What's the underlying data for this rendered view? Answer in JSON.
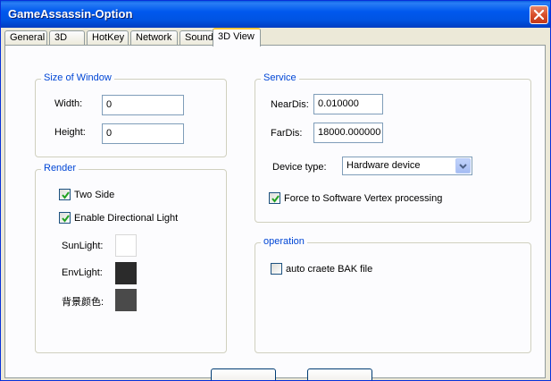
{
  "window": {
    "title": "GameAssassin-Option"
  },
  "tabs": [
    {
      "label": "General"
    },
    {
      "label": "3D"
    },
    {
      "label": "HotKey"
    },
    {
      "label": "Network"
    },
    {
      "label": "Sound"
    },
    {
      "label": "3D View",
      "active": true
    }
  ],
  "size_of_window": {
    "title": "Size of Window",
    "width_label": "Width:",
    "width_value": "0",
    "height_label": "Height:",
    "height_value": "0"
  },
  "render": {
    "title": "Render",
    "two_side": {
      "label": "Two Side",
      "checked": true
    },
    "directional_light": {
      "label": "Enable Directional Light",
      "checked": true
    },
    "sunlight_label": "SunLight:",
    "envlight_label": "EnvLight:",
    "background_color_label": "背景颜色:",
    "colors": {
      "sunlight": "#ffffff",
      "envlight": "#2b2b2b",
      "background": "#4a4a4a"
    }
  },
  "service": {
    "title": "Service",
    "neardis_label": "NearDis:",
    "neardis_value": "0.010000",
    "fardis_label": "FarDis:",
    "fardis_value": "18000.000000",
    "device_type_label": "Device type:",
    "device_type_value": "Hardware device",
    "force_software": {
      "label": "Force to Software Vertex processing",
      "checked": true
    }
  },
  "operation": {
    "title": "operation",
    "auto_bak": {
      "label": "auto craete BAK file",
      "checked": false
    }
  },
  "icons": {
    "close": "close-icon",
    "dropdown": "chevron-down-icon",
    "check": "checkmark-icon"
  }
}
